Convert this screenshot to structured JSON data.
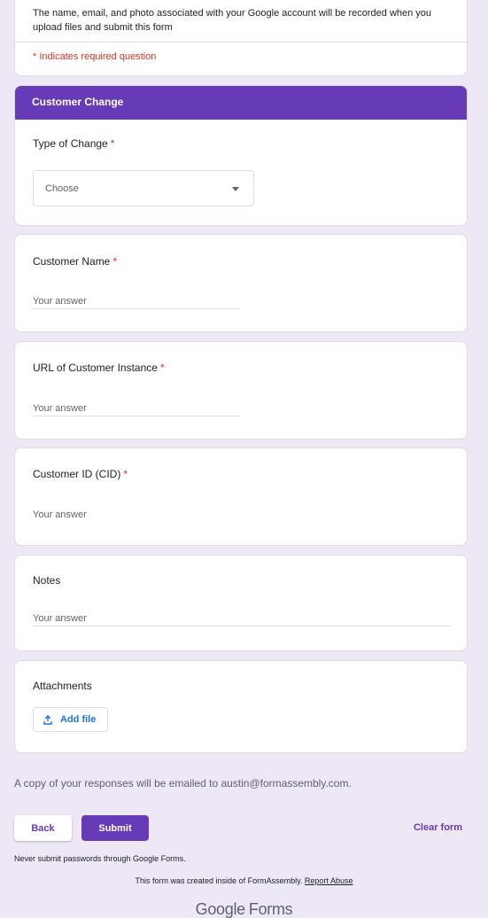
{
  "intro": {
    "description": "The name, email, and photo associated with your Google account will be recorded when you upload files and submit this form",
    "required_note": "* Indicates required question"
  },
  "section": {
    "title": "Customer Change"
  },
  "questions": {
    "type_of_change": {
      "title": "Type of Change",
      "required_mark": "*",
      "dropdown_value": "Choose"
    },
    "customer_name": {
      "title": "Customer Name",
      "required_mark": "*",
      "placeholder": "Your answer"
    },
    "url_instance": {
      "title": "URL of Customer Instance",
      "required_mark": "*",
      "placeholder": "Your answer"
    },
    "customer_id": {
      "title": "Customer ID (CID)",
      "required_mark": "*",
      "placeholder": "Your answer"
    },
    "notes": {
      "title": "Notes",
      "placeholder": "Your answer"
    },
    "attachments": {
      "title": "Attachments",
      "add_file_label": "Add file"
    }
  },
  "footer": {
    "copy_note": "A copy of your responses will be emailed to austin@formassembly.com.",
    "back_label": "Back",
    "submit_label": "Submit",
    "clear_label": "Clear form",
    "password_note": "Never submit passwords through Google Forms.",
    "created_note": "This form was created inside of FormAssembly.",
    "report_abuse": "Report Abuse",
    "logo_google": "Google",
    "logo_forms": "Forms"
  },
  "icons": {
    "dropdown": "caret-down-icon",
    "upload": "upload-icon"
  },
  "colors": {
    "accent": "#673ab7",
    "background": "#ede7f6",
    "required": "#d93025",
    "link_blue": "#1a73e8"
  }
}
